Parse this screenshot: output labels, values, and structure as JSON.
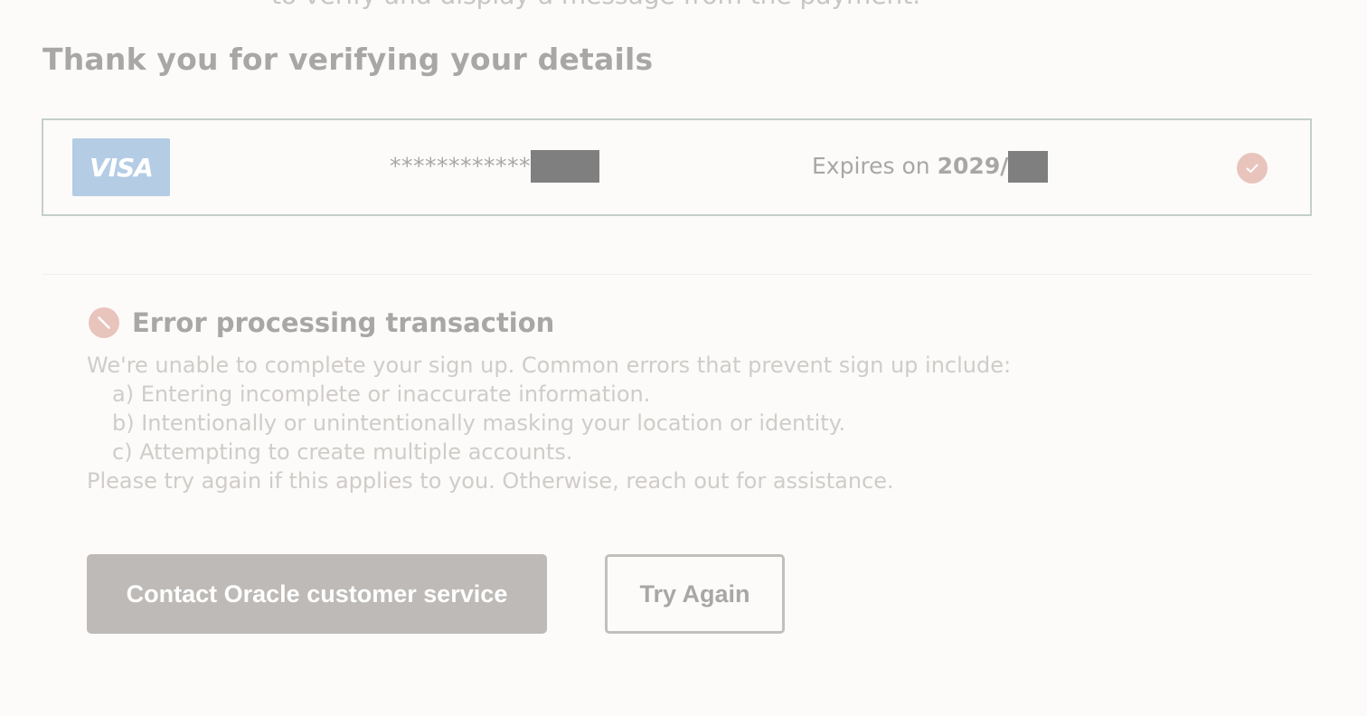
{
  "page": {
    "top_cut_text": "to verify and display a message from the payment.",
    "title": "Thank you for verifying your details"
  },
  "card": {
    "brand": "VISA",
    "number_mask": "************",
    "expiry_label": "Expires on",
    "expiry_year": "2029/",
    "verified_icon": "check-icon"
  },
  "error": {
    "icon": "prohibited-icon",
    "title": "Error processing transaction",
    "intro": "We're unable to complete your sign up. Common errors that prevent sign up include:",
    "reasons": [
      "a) Entering incomplete or inaccurate information.",
      "b) Intentionally or unintentionally masking your location or identity.",
      "c) Attempting to create multiple accounts."
    ],
    "outro": "Please try again if this applies to you. Otherwise, reach out for assistance."
  },
  "actions": {
    "contact_label": "Contact Oracle customer service",
    "try_again_label": "Try Again"
  },
  "colors": {
    "background": "#fcfbfa",
    "primary_button": "#bebab7",
    "card_border": "#c4cfca",
    "visa_blue": "#b4cce4",
    "status_icon": "#e8c4bd"
  }
}
